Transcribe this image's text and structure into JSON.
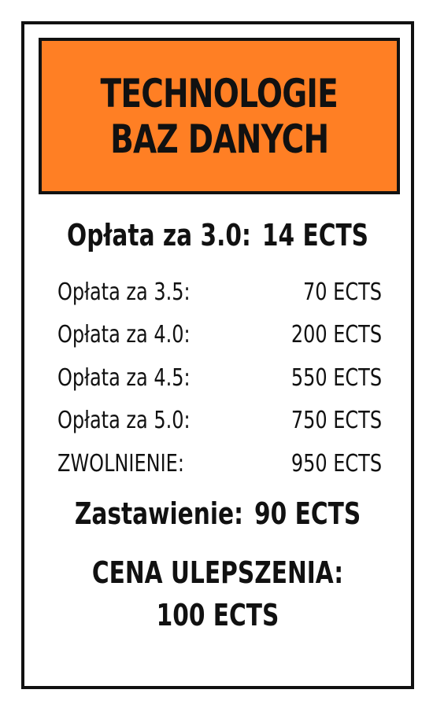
{
  "card": {
    "title_line1": "TECHNOLOGIE",
    "title_line2": "BAZ DANYCH",
    "title_color": "#ff7f24",
    "base_rent_label": "Opłata za 3.0:",
    "base_rent_value": "14 ECTS",
    "rent_rows": [
      {
        "label": "Opłata za 3.5:",
        "value": "70 ECTS"
      },
      {
        "label": "Opłata za 4.0:",
        "value": "200 ECTS"
      },
      {
        "label": "Opłata za 4.5:",
        "value": "550 ECTS"
      },
      {
        "label": "Opłata za 5.0:",
        "value": "750 ECTS"
      },
      {
        "label": "ZWOLNIENIE:",
        "value": "950 ECTS"
      }
    ],
    "mortgage_label": "Zastawienie:",
    "mortgage_value": "90 ECTS",
    "upgrade_label": "CENA ULEPSZENIA:",
    "upgrade_value": "100 ECTS"
  }
}
